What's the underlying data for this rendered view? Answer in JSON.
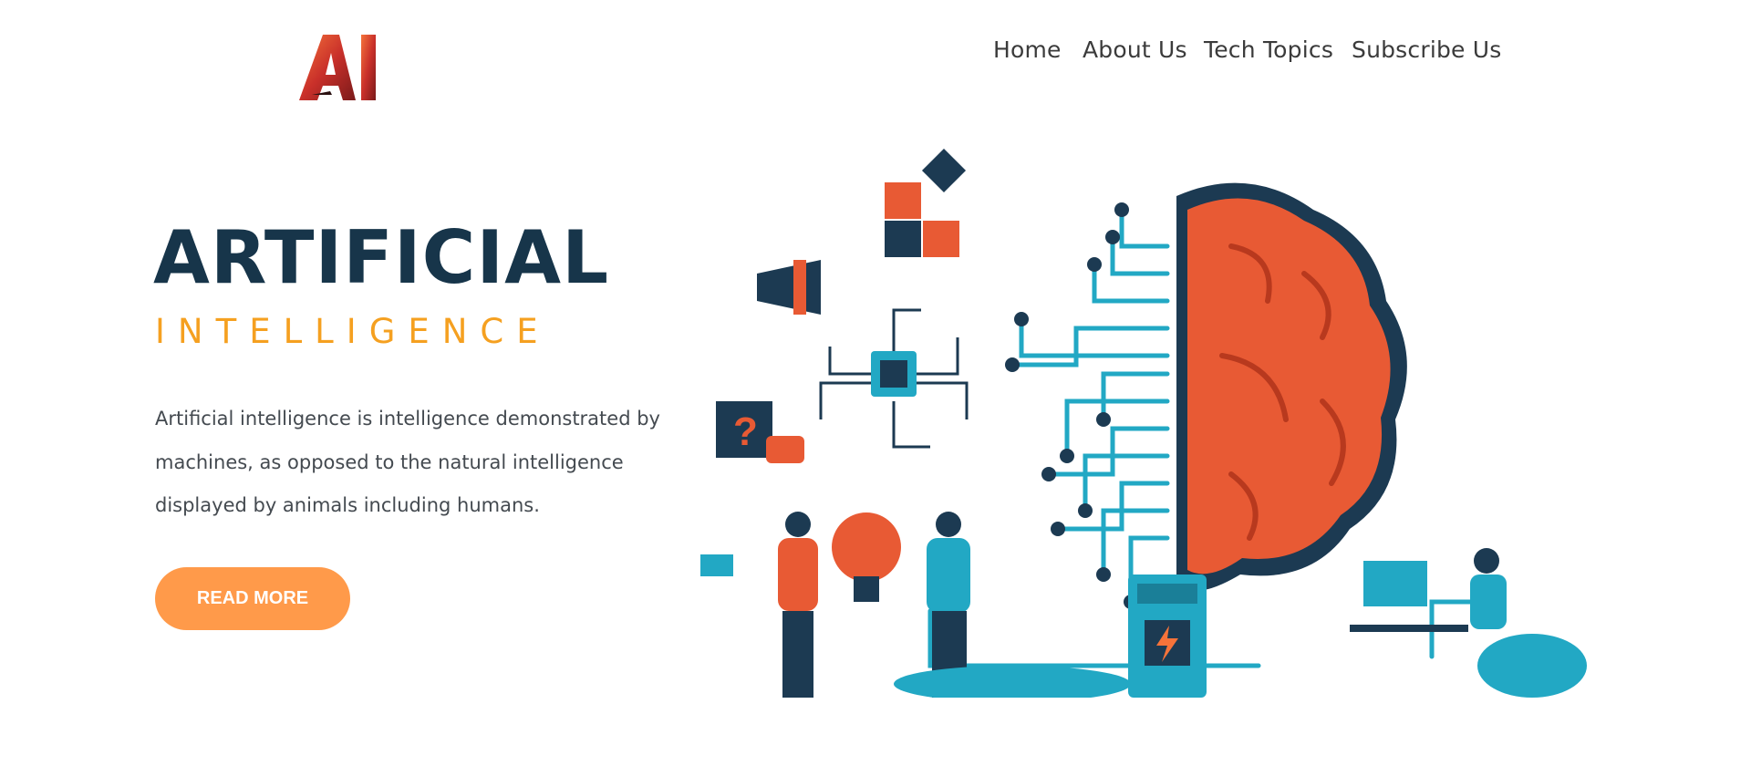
{
  "header": {
    "logo_text": "AI",
    "nav": [
      "Home",
      "About Us",
      "Tech Topics",
      "Subscribe Us"
    ]
  },
  "hero": {
    "title": "ARTIFICIAL",
    "subtitle": "INTELLIGENCE",
    "description": "Artificial intelligence is intelligence demonstrated by machines, as opposed to the natural intelligence displayed by animals including humans.",
    "button_label": "READ MORE"
  },
  "colors": {
    "navy": "#17354a",
    "accent_orange": "#f5a020",
    "button": "#ff9a4a",
    "brain": "#e85a34",
    "teal": "#22a8c4"
  }
}
